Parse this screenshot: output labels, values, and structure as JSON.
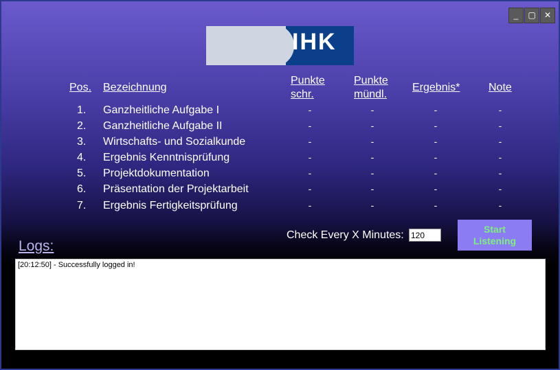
{
  "window": {
    "controls": {
      "minimize": "_",
      "maximize": "▢",
      "close": "✕"
    }
  },
  "logo": {
    "text": "IHK",
    "colors": {
      "dark": "#0b3f8a",
      "light": "#cfd6e2"
    }
  },
  "table": {
    "headers": {
      "pos": "Pos.",
      "bezeichnung": "Bezeichnung",
      "punkte_schr_line1": "Punkte",
      "punkte_schr_line2": "schr.",
      "punkte_muendl_line1": "Punkte",
      "punkte_muendl_line2": "mündl.",
      "ergebnis": "Ergebnis*",
      "note": "Note"
    },
    "rows": [
      {
        "pos": "1.",
        "name": "Ganzheitliche Aufgabe I",
        "schr": "-",
        "muendl": "-",
        "ergebnis": "-",
        "note": "-"
      },
      {
        "pos": "2.",
        "name": "Ganzheitliche Aufgabe II",
        "schr": "-",
        "muendl": "-",
        "ergebnis": "-",
        "note": "-"
      },
      {
        "pos": "3.",
        "name": "Wirtschafts- und Sozialkunde",
        "schr": "-",
        "muendl": "-",
        "ergebnis": "-",
        "note": "-"
      },
      {
        "pos": "4.",
        "name": "Ergebnis Kenntnisprüfung",
        "schr": "-",
        "muendl": "-",
        "ergebnis": "-",
        "note": "-"
      },
      {
        "pos": "5.",
        "name": "Projektdokumentation",
        "schr": "-",
        "muendl": "-",
        "ergebnis": "-",
        "note": "-"
      },
      {
        "pos": "6.",
        "name": "Präsentation der Projektarbeit",
        "schr": "-",
        "muendl": "-",
        "ergebnis": "-",
        "note": "-"
      },
      {
        "pos": "7.",
        "name": "Ergebnis Fertigkeitsprüfung",
        "schr": "-",
        "muendl": "-",
        "ergebnis": "-",
        "note": "-"
      }
    ]
  },
  "controls": {
    "check_label": "Check Every X Minutes:",
    "interval_value": "120",
    "start_line1": "Start",
    "start_line2": "Listening"
  },
  "logs": {
    "label": "Logs:",
    "entries": [
      "[20:12:50] - Successfully logged in!"
    ]
  }
}
